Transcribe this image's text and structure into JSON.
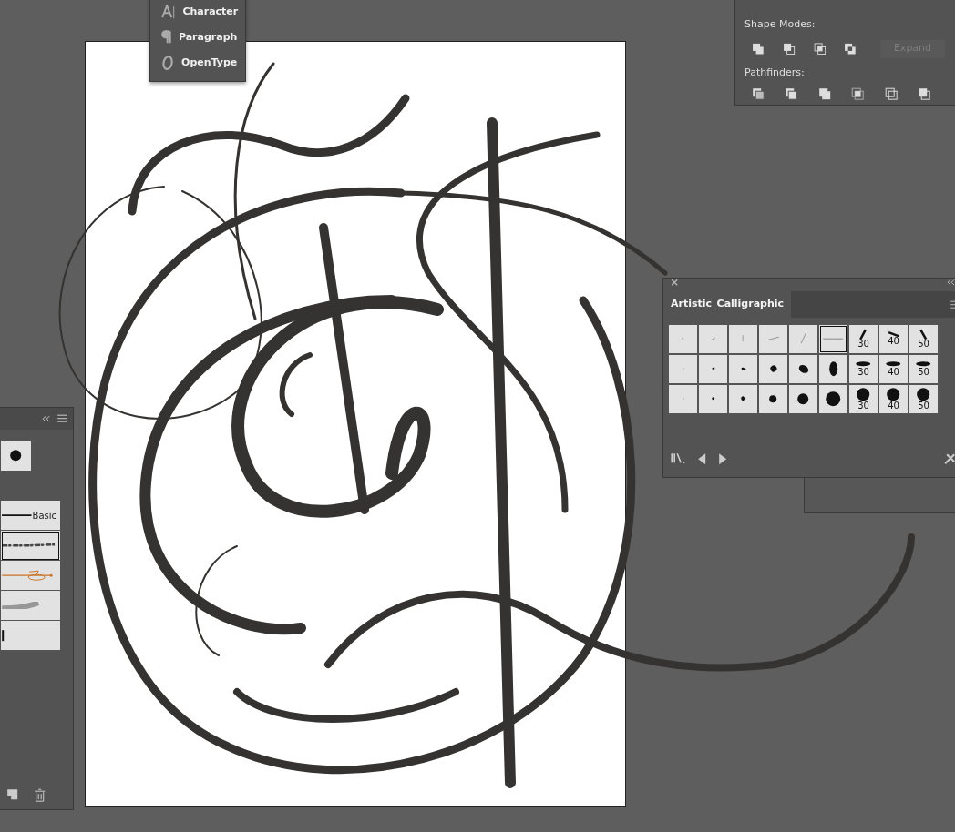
{
  "type_menu": {
    "items": [
      {
        "kind": "character",
        "label": "Character"
      },
      {
        "kind": "paragraph",
        "label": "Paragraph"
      },
      {
        "kind": "opentype",
        "label": "OpenType"
      }
    ]
  },
  "pathfinder": {
    "shape_modes_label": "Shape Modes:",
    "expand_button": {
      "label": "Expand",
      "disabled": true
    },
    "pathfinders_label": "Pathfinders:"
  },
  "brushes_panel": {
    "items": [
      {
        "kind": "basic",
        "label": "Basic",
        "selected": false
      },
      {
        "kind": "charcoal",
        "selected": true
      },
      {
        "kind": "arrow",
        "selected": false
      },
      {
        "kind": "airbrush",
        "selected": false
      },
      {
        "kind": "pattern",
        "selected": false
      }
    ]
  },
  "brush_library": {
    "tab": "Artistic_Calligraphic",
    "rows": [
      {
        "kind": "flat",
        "cells": [
          {
            "selected": false
          },
          {
            "selected": false
          },
          {
            "selected": false
          },
          {
            "selected": false
          },
          {
            "selected": false
          },
          {
            "selected": true
          },
          {
            "label": "30",
            "selected": false
          },
          {
            "label": "40",
            "selected": false
          },
          {
            "label": "50",
            "selected": false
          }
        ]
      },
      {
        "kind": "oval",
        "cells": [
          {
            "selected": false
          },
          {
            "selected": false
          },
          {
            "selected": false
          },
          {
            "selected": false
          },
          {
            "selected": false
          },
          {
            "selected": false
          },
          {
            "label": "30",
            "selected": false
          },
          {
            "label": "40",
            "selected": false
          },
          {
            "label": "50",
            "selected": false
          }
        ]
      },
      {
        "kind": "round",
        "cells": [
          {
            "selected": false
          },
          {
            "selected": false
          },
          {
            "selected": false
          },
          {
            "selected": false
          },
          {
            "selected": false
          },
          {
            "selected": false
          },
          {
            "label": "30",
            "selected": false
          },
          {
            "label": "40",
            "selected": false
          },
          {
            "label": "50",
            "selected": false
          }
        ]
      }
    ]
  }
}
